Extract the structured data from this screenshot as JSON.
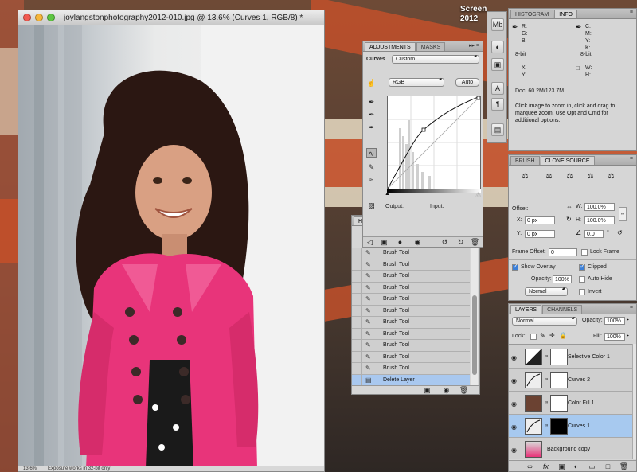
{
  "desktop": {
    "label_line1": "Screen",
    "label_line2": "2012"
  },
  "image_window": {
    "title": "joylangstonphotography2012-010.jpg @ 13.6% (Curves 1, RGB/8) *",
    "status_zoom": "13.6%",
    "status_info": "Exposure works in 32-bit only"
  },
  "adjustments_panel": {
    "tabs": [
      "ADJUSTMENTS",
      "MASKS"
    ],
    "curves_label": "Curves",
    "preset_value": "Custom",
    "channel_value": "RGB",
    "auto_button": "Auto",
    "output_label": "Output:",
    "input_label": "Input:"
  },
  "history_panel": {
    "tab": "HIS",
    "items": [
      "Brush Tool",
      "Brush Tool",
      "Brush Tool",
      "Brush Tool",
      "Brush Tool",
      "Brush Tool",
      "Brush Tool",
      "Brush Tool",
      "Brush Tool",
      "Brush Tool",
      "Brush Tool",
      "Delete Layer"
    ],
    "selected_index": 11
  },
  "info_panel": {
    "tabs": [
      "HISTOGRAM",
      "INFO"
    ],
    "rgb_labels": [
      "R:",
      "G:",
      "B:"
    ],
    "cmyk_labels": [
      "C:",
      "M:",
      "Y:",
      "K:"
    ],
    "bit_left": "8-bit",
    "bit_right": "8-bit",
    "xy_labels": [
      "X:",
      "Y:"
    ],
    "wh_labels": [
      "W:",
      "H:"
    ],
    "doc": "Doc: 60.2M/123.7M",
    "help": "Click image to zoom in, click and drag to marquee zoom.  Use Opt and Cmd for additional options."
  },
  "clone_panel": {
    "tabs": [
      "BRUSH",
      "CLONE SOURCE"
    ],
    "offset_label": "Offset:",
    "w_label": "W:",
    "w_value": "100.0%",
    "h_label": "H:",
    "h_value": "100.0%",
    "x_label": "X:",
    "x_value": "0 px",
    "y_label": "Y:",
    "y_value": "0 px",
    "angle_value": "0.0",
    "degree": "°",
    "frame_offset_label": "Frame Offset:",
    "frame_offset_value": "0",
    "lock_frame": "Lock Frame",
    "show_overlay": "Show Overlay",
    "clipped": "Clipped",
    "opacity_label": "Opacity:",
    "opacity_value": "100%",
    "auto_hide": "Auto Hide",
    "blend_value": "Normal",
    "invert": "Invert"
  },
  "layers_panel": {
    "tabs": [
      "LAYERS",
      "CHANNELS"
    ],
    "blend_mode": "Normal",
    "opacity_label": "Opacity:",
    "opacity_value": "100%",
    "lock_label": "Lock:",
    "fill_label": "Fill:",
    "fill_value": "100%",
    "layers": [
      {
        "name": "Selective Color 1",
        "selected": false
      },
      {
        "name": "Curves 2",
        "selected": false
      },
      {
        "name": "Color Fill 1",
        "selected": false
      },
      {
        "name": "Curves 1",
        "selected": true
      },
      {
        "name": "Background copy",
        "selected": false
      }
    ]
  },
  "colors": {
    "accent": "#3b7fd8",
    "selection": "#a7c9ef",
    "flag_red": "#c2502a",
    "flag_cream": "#e8dcc4",
    "coat_pink": "#e8347a",
    "color_fill_swatch": "#6b4232"
  }
}
